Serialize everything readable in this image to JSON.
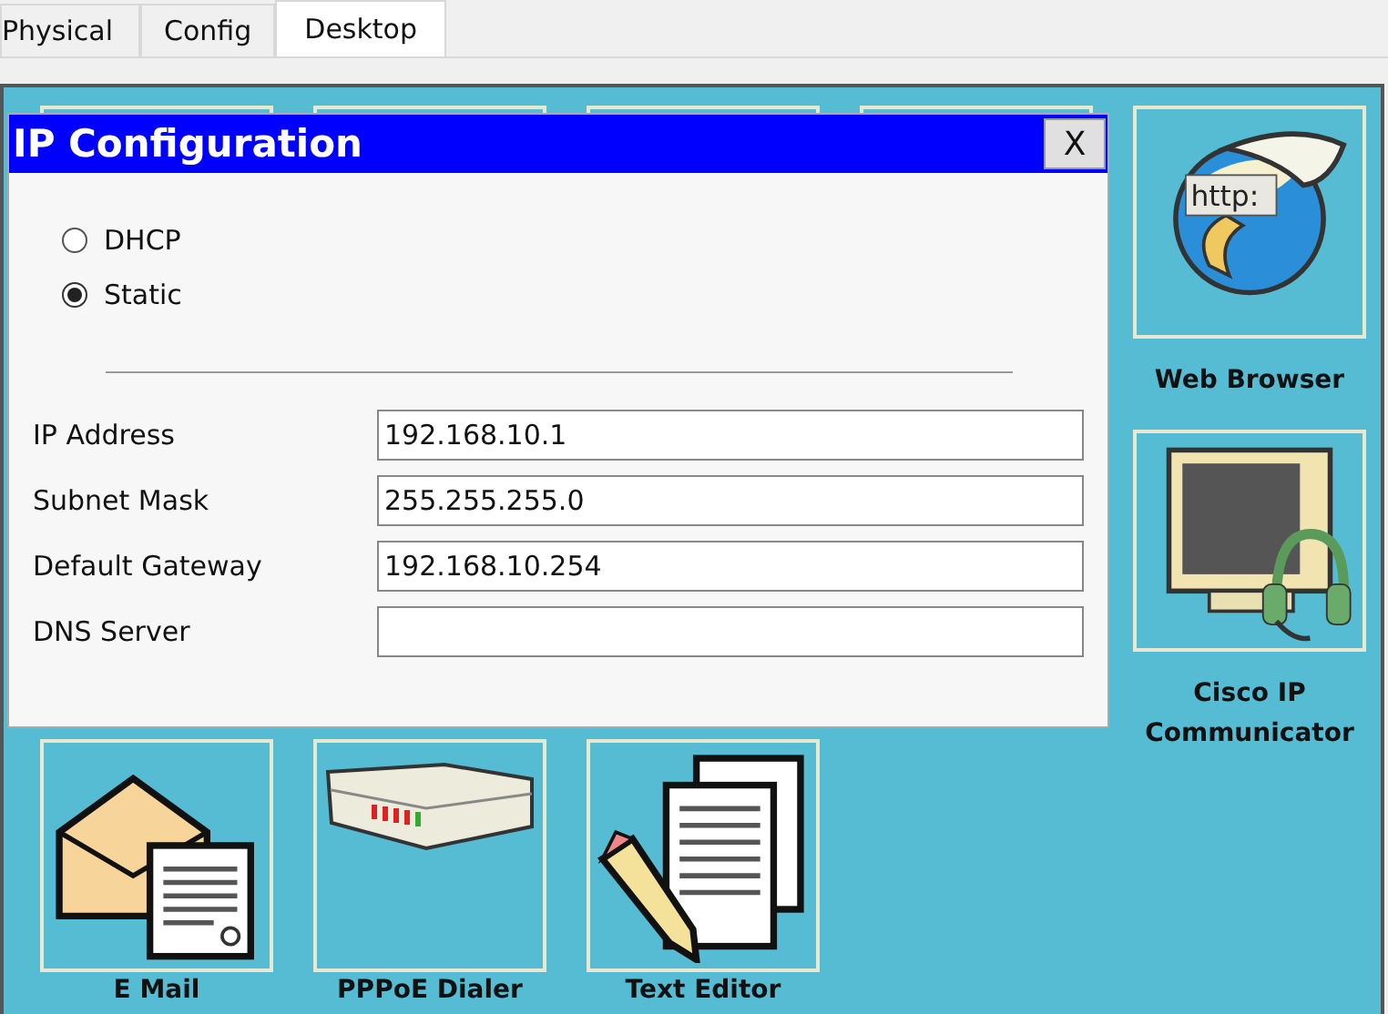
{
  "tabs": [
    {
      "label": "Physical",
      "selected": false
    },
    {
      "label": "Config",
      "selected": false
    },
    {
      "label": "Desktop",
      "selected": true
    }
  ],
  "desktop": {
    "side_apps": [
      {
        "label": "Web Browser",
        "kind": "browser",
        "icon_text": "http:"
      },
      {
        "label": "Cisco IP Communicator",
        "kind": "phone"
      }
    ],
    "bottom_apps": [
      {
        "label": "E Mail",
        "kind": "mail"
      },
      {
        "label": "PPPoE Dialer",
        "kind": "dialer"
      },
      {
        "label": "Text Editor",
        "kind": "editor"
      }
    ]
  },
  "dialog": {
    "title": "IP Configuration",
    "close": "X",
    "modes": [
      {
        "label": "DHCP",
        "selected": false
      },
      {
        "label": "Static",
        "selected": true
      }
    ],
    "fields": [
      {
        "label": "IP Address",
        "value": "192.168.10.1"
      },
      {
        "label": "Subnet Mask",
        "value": "255.255.255.0"
      },
      {
        "label": "Default Gateway",
        "value": "192.168.10.254"
      },
      {
        "label": "DNS Server"
      }
    ]
  }
}
